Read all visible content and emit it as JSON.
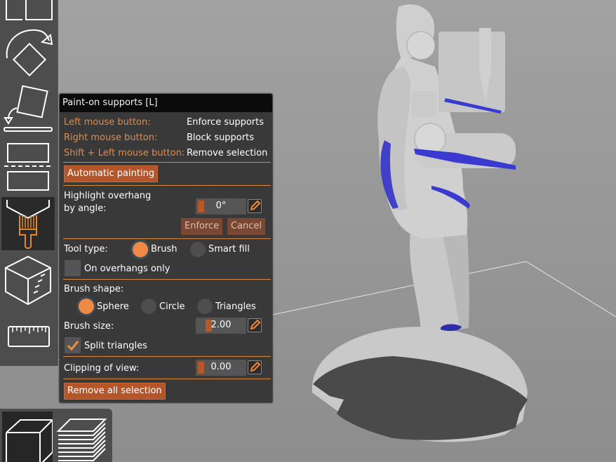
{
  "panel": {
    "title": "Paint-on supports [L]",
    "mouse_hints": [
      {
        "action": "Left mouse button:",
        "result": "Enforce supports"
      },
      {
        "action": "Right mouse button:",
        "result": "Block supports"
      },
      {
        "action": "Shift + Left mouse button:",
        "result": "Remove selection"
      }
    ],
    "automatic_painting_label": "Automatic painting",
    "highlight_overhang": {
      "label_line1": "Highlight overhang",
      "label_line2": "by angle:",
      "value": "0°",
      "enforce_label": "Enforce",
      "cancel_label": "Cancel"
    },
    "tool_type": {
      "label": "Tool type:",
      "options": [
        "Brush",
        "Smart fill"
      ],
      "selected": "Brush"
    },
    "on_overhangs_only": {
      "label": "On overhangs only",
      "checked": false
    },
    "brush_shape": {
      "label": "Brush shape:",
      "options": [
        "Sphere",
        "Circle",
        "Triangles"
      ],
      "selected": "Sphere"
    },
    "brush_size": {
      "label": "Brush size:",
      "value": "2.00"
    },
    "split_triangles": {
      "label": "Split triangles",
      "checked": true
    },
    "clipping_of_view": {
      "label": "Clipping of view:",
      "value": "0.00"
    },
    "remove_all_label": "Remove all selection"
  },
  "left_toolbar": {
    "tools": [
      "select-area-icon",
      "rotate-icon",
      "place-on-face-icon",
      "cut-icon",
      "paint-supports-icon",
      "seam-painting-icon",
      "measure-icon"
    ],
    "active": "paint-supports-icon"
  },
  "view_toolbar": {
    "buttons": [
      "3d-view-icon",
      "layers-preview-icon"
    ],
    "active": "3d-view-icon"
  },
  "colors": {
    "accent": "#e8913f",
    "button": "#b5562a",
    "support_paint": "#3a3ad0",
    "panel_bg": "#393939"
  }
}
